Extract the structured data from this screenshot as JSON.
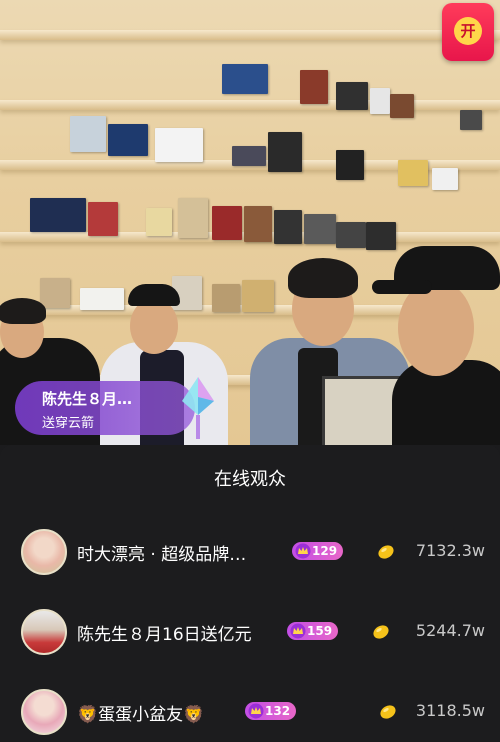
{
  "red_packet": {
    "label": "开"
  },
  "gift_notice": {
    "sender": "陈先生８月…",
    "action": "送穿云箭"
  },
  "audience": {
    "title": "在线观众",
    "users": [
      {
        "name": "时大漂亮 · 超级品牌…",
        "level": "129",
        "score": "7132.3w"
      },
      {
        "name": "陈先生８月16日送亿元",
        "level": "159",
        "score": "5244.7w"
      },
      {
        "name": "蛋蛋小盆友",
        "prefix_emoji": "🦁",
        "suffix_emoji": "🦁",
        "level": "132",
        "score": "3118.5w"
      }
    ]
  },
  "colors": {
    "panel_bg": "#1c1c1e",
    "badge": "#d35be0",
    "gift_bubble": "#8a4ad6",
    "red_packet": "#f2214f"
  }
}
